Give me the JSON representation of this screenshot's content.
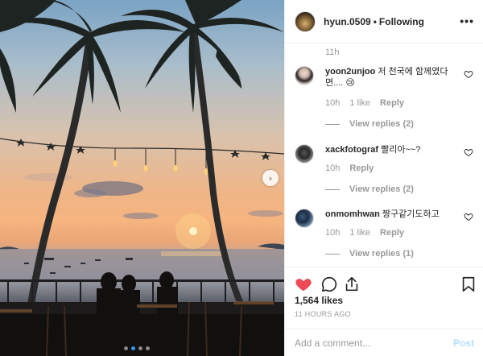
{
  "header": {
    "username": "hyun.0509",
    "separator": "•",
    "follow_status": "Following",
    "more_icon": "more-horizontal-icon"
  },
  "caption": {
    "time": "11h"
  },
  "comments": [
    {
      "username": "yoon2unjoo",
      "text": "저 천국에 함께였다면.... 😢",
      "time": "10h",
      "likes": "1 like",
      "reply": "Reply",
      "view_replies": "View replies (2)"
    },
    {
      "username": "xackfotograf",
      "text": "빨리아~~?",
      "time": "10h",
      "likes": "",
      "reply": "Reply",
      "view_replies": "View replies (2)"
    },
    {
      "username": "onmomhwan",
      "text": "짱구같기도하고",
      "time": "10h",
      "likes": "1 like",
      "reply": "Reply",
      "view_replies": "View replies (1)"
    }
  ],
  "actions": {
    "like_icon": "heart-filled-icon",
    "comment_icon": "comment-icon",
    "share_icon": "share-icon",
    "save_icon": "bookmark-icon",
    "likes_count": "1,564 likes",
    "timestamp": "11 HOURS AGO"
  },
  "add_comment": {
    "placeholder": "Add a comment...",
    "post_label": "Post"
  },
  "carousel": {
    "next_icon": "chevron-right-icon",
    "slide_count": 4,
    "active_index": 1
  },
  "colors": {
    "like_red": "#ed4956",
    "accent_blue": "#3897f0",
    "post_disabled": "#b2dffc",
    "meta_gray": "#999999"
  }
}
